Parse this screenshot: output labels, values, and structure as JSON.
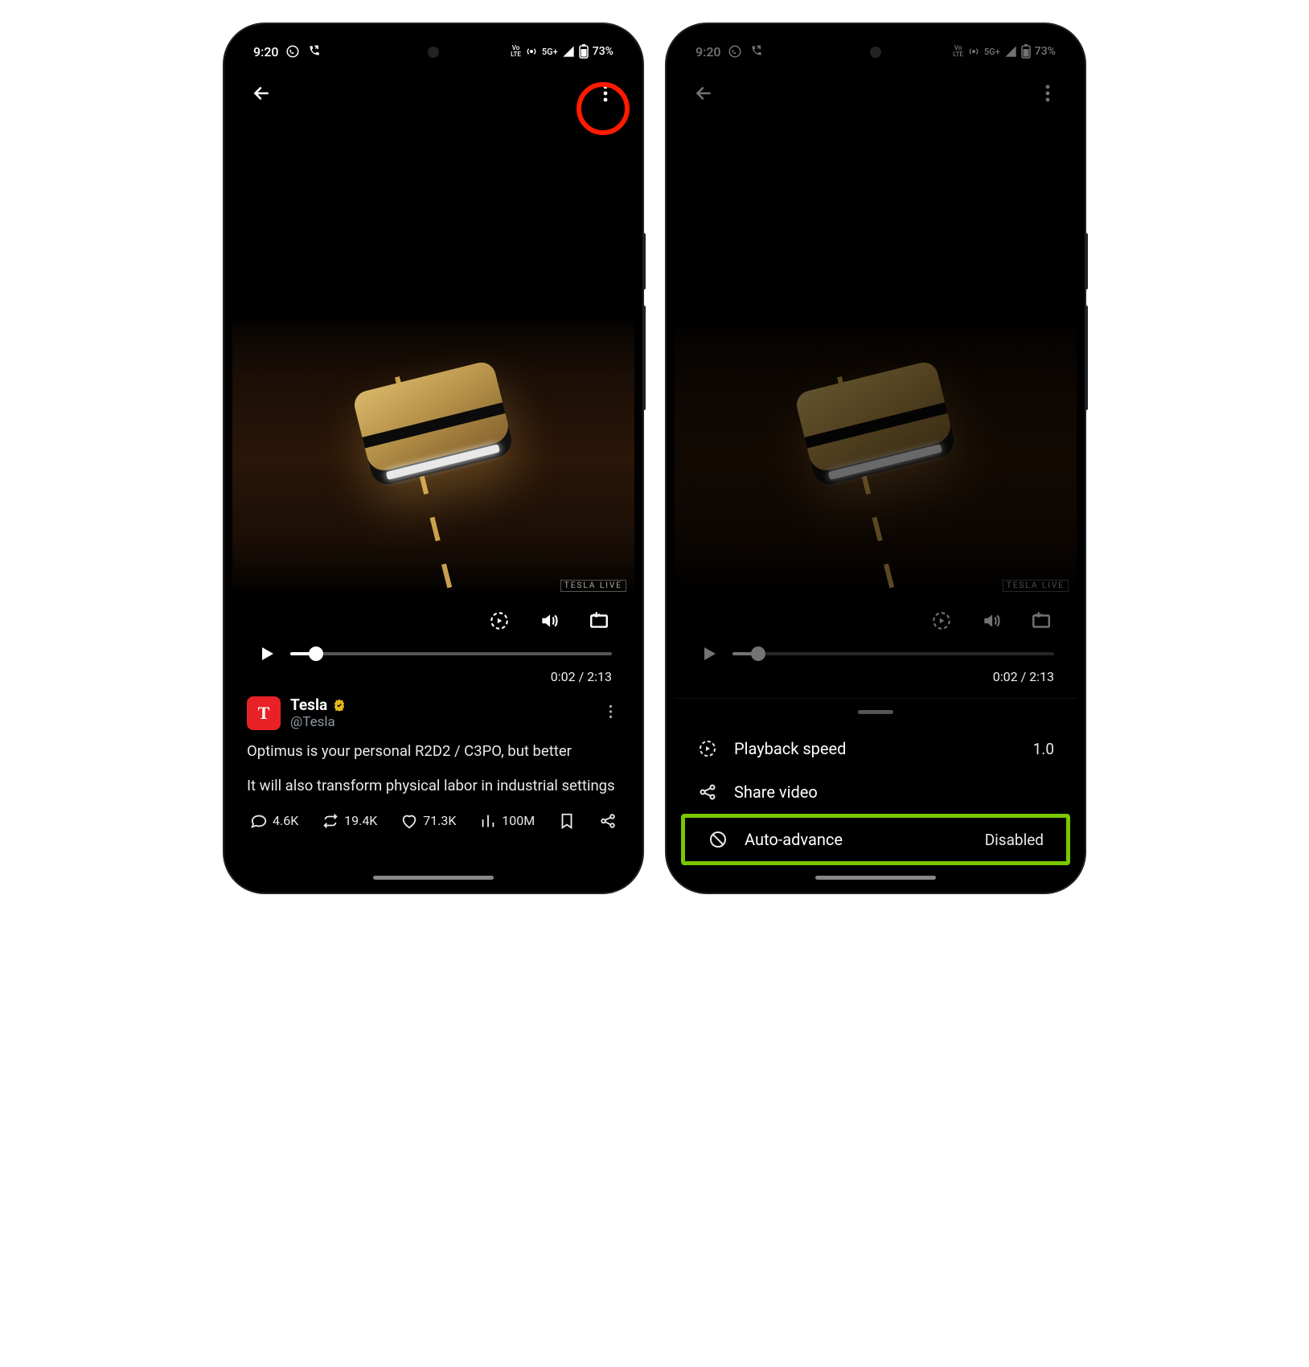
{
  "statusbar": {
    "time": "9:20",
    "network_label": "5G+",
    "volte_label": "Vo LTE",
    "battery_text": "73%"
  },
  "player": {
    "elapsed": "0:02",
    "duration": "2:13",
    "time_display": "0:02 / 2:13",
    "live_badge": "TESLA  LIVE"
  },
  "post": {
    "avatar_letter": "T",
    "display_name": "Tesla",
    "handle": "@Tesla",
    "line1": "Optimus is your personal R2D2 / C3PO, but better",
    "line2": "It will also transform physical labor in industrial settings"
  },
  "actions": {
    "replies": "4.6K",
    "reposts": "19.4K",
    "likes": "71.3K",
    "views": "100M"
  },
  "sheet": {
    "playback_speed_label": "Playback speed",
    "playback_speed_value": "1.0",
    "share_label": "Share video",
    "auto_advance_label": "Auto-advance",
    "auto_advance_value": "Disabled"
  }
}
